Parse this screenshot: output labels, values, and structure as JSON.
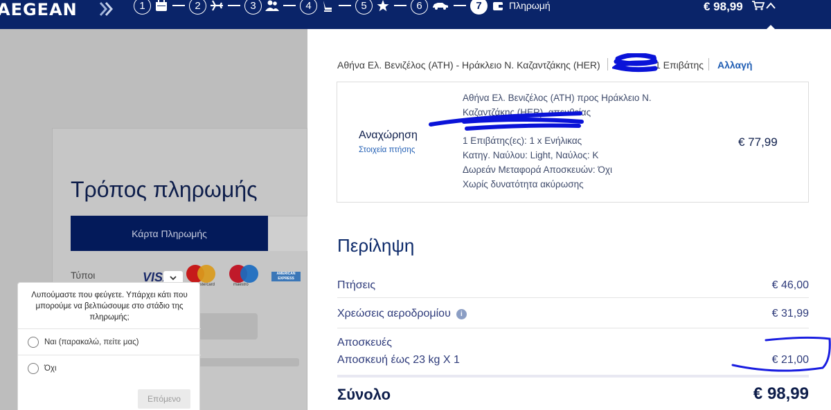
{
  "header": {
    "logo": "AEGEAN",
    "steps": [
      {
        "num": "1",
        "icon": "calendar-icon"
      },
      {
        "num": "2",
        "icon": "plane-icon"
      },
      {
        "num": "3",
        "icon": "passengers-icon"
      },
      {
        "num": "4",
        "icon": "seat-icon"
      },
      {
        "num": "5",
        "icon": "star-icon"
      },
      {
        "num": "6",
        "icon": "car-icon"
      },
      {
        "num": "7",
        "icon": "wallet-icon",
        "label": "Πληρωμή"
      }
    ],
    "total": "€ 98,99"
  },
  "payment": {
    "title": "Τρόπος πληρωμής",
    "tab_card": "Κάρτα Πληρωμής",
    "types_label": "Τύποι",
    "visa": "VISA",
    "mastercard": "mastercard",
    "maestro": "maestro",
    "amex": "AMERICAN EXPRESS"
  },
  "survey": {
    "question": "Λυπούμαστε που φεύγετε. Υπάρχει κάτι που μπορούμε να βελτιώσουμε στο στάδιο της πληρωμής;",
    "option_yes": "Ναι (παρακαλώ, πείτε μας)",
    "option_no": "Όχι",
    "next": "Επόμενο"
  },
  "trip": {
    "route": "Αθήνα Ελ. Βενιζέλος (ATH) - Ηράκλειο Ν. Καζαντζάκης (HER)",
    "passengers": "1 Επιβάτης",
    "change": "Αλλαγή"
  },
  "flight": {
    "departure": "Αναχώρηση",
    "details_link": "Στοιχεία πτήσης",
    "line1": "Αθήνα Ελ. Βενιζέλος (ATH) προς Ηράκλειο Ν.",
    "line2": "Καζαντζάκης (HER), απευθείας",
    "pax": "1 Επιβάτης(ες): 1 x Ενήλικας",
    "fare": "Κατηγ. Ναύλου: Light, Ναύλος: K",
    "baggage": "Δωρεάν Μεταφορά Αποσκευών: Όχι",
    "cancel": "Χωρίς δυνατότητα ακύρωσης",
    "price": "€ 77,99"
  },
  "summary": {
    "title": "Περίληψη",
    "flights_label": "Πτήσεις",
    "flights_amt": "€ 46,00",
    "airport_label": "Χρεώσεις αεροδρομίου",
    "airport_amt": "€ 31,99",
    "bags_label": "Αποσκευές",
    "bag_item_label": "Αποσκευή έως 23 kg X 1",
    "bag_item_amt": "€ 21,00",
    "total_label": "Σύνολο",
    "total_amt": "€ 98,99"
  }
}
